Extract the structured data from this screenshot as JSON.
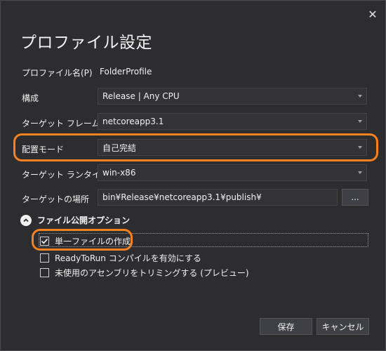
{
  "dialog": {
    "title": "プロファイル設定",
    "close_glyph": "✕"
  },
  "profile_name": {
    "label": "プロファイル名(P)",
    "value": "FolderProfile"
  },
  "configuration": {
    "label": "構成",
    "value": "Release | Any CPU"
  },
  "target_framework": {
    "label": "ターゲット フレームワーク",
    "value": "netcoreapp3.1"
  },
  "deployment_mode": {
    "label": "配置モード",
    "value": "自己完結"
  },
  "target_runtime": {
    "label": "ターゲット ランタイム",
    "value": "win-x86"
  },
  "target_location": {
    "label": "ターゲットの場所",
    "value": "bin¥Release¥netcoreapp3.1¥publish¥",
    "browse_label": "..."
  },
  "file_publish_options": {
    "label": "ファイル公開オプション",
    "options": [
      {
        "label": "単一ファイルの作成",
        "checked": true
      },
      {
        "label": "ReadyToRun コンパイルを有効にする",
        "checked": false
      },
      {
        "label": "未使用のアセンブリをトリミングする (プレビュー)",
        "checked": false
      }
    ]
  },
  "buttons": {
    "save_label": "保存",
    "cancel_label": "キャンセル"
  },
  "colors": {
    "highlight": "#f5811f",
    "background": "#2d2d30",
    "field": "#333337"
  }
}
